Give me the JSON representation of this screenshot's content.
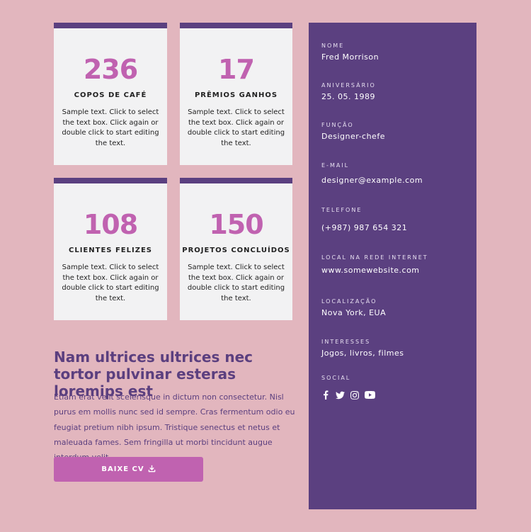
{
  "stats": [
    {
      "value": "236",
      "label": "COPOS DE CAFÉ",
      "desc": "Sample text. Click to select the text box. Click again or double click to start editing the text."
    },
    {
      "value": "17",
      "label": "PRÊMIOS GANHOS",
      "desc": "Sample text. Click to select the text box. Click again or double click to start editing the text."
    },
    {
      "value": "108",
      "label": "CLIENTES FELIZES",
      "desc": "Sample text. Click to select the text box. Click again or double click to start editing the text."
    },
    {
      "value": "150",
      "label": "PROJETOS CONCLUÍDOS",
      "desc": "Sample text. Click to select the text box. Click again or double click to start editing the text."
    }
  ],
  "intro": {
    "headline": "Nam ultrices ultrices nec tortor pulvinar esteras loremips est",
    "body": "Etiam erat velit scelerisque in dictum non consectetur. Nisl purus em mollis nunc sed id sempre. Cras fermentum odio eu feugiat pretium nibh ipsum. Tristique senectus et netus et maleuada fames. Sem fringilla ut morbi tincidunt augue interdum velit.",
    "button_label": "BAIXE CV"
  },
  "profile": {
    "name": {
      "label": "NOME",
      "value": "Fred Morrison"
    },
    "birthday": {
      "label": "ANIVERSÁRIO",
      "value": "25. 05. 1989"
    },
    "role": {
      "label": "FUNÇÃO",
      "value": "Designer-chefe"
    },
    "email": {
      "label": "E-MAIL",
      "value": "designer@example.com"
    },
    "phone": {
      "label": "TELEFONE",
      "value": "(+987) 987 654 321"
    },
    "website": {
      "label": "LOCAL NA REDE INTERNET",
      "value": "www.somewebsite.com"
    },
    "location": {
      "label": "LOCALIZAÇÃO",
      "value": "Nova York, EUA"
    },
    "interests": {
      "label": "INTERESSES",
      "value": "Jogos, livros, filmes"
    },
    "social": {
      "label": "SOCIAL",
      "icons": [
        "facebook-icon",
        "twitter-icon",
        "instagram-icon",
        "youtube-icon"
      ]
    }
  },
  "colors": {
    "background": "#e2b6be",
    "panel": "#5b4080",
    "accent": "#c062b0",
    "card": "#f2f2f3"
  }
}
